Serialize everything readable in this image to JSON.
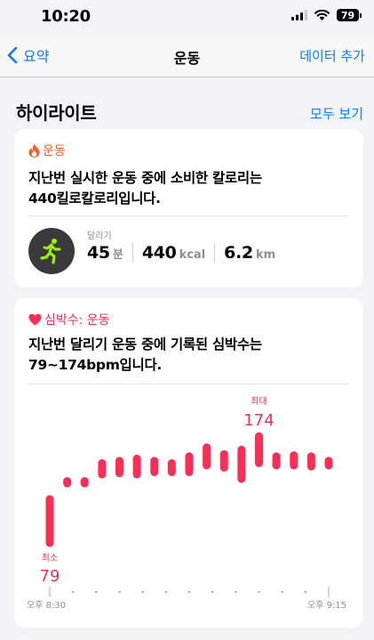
{
  "status_bar": {
    "time": "10:20",
    "battery": "79"
  },
  "nav": {
    "back_label": "요약",
    "title": "운동",
    "action_label": "데이터 추가"
  },
  "highlights": {
    "title": "하이라이트",
    "show_all": "모두 보기"
  },
  "workout_card": {
    "category": "운동",
    "headline_line1": "지난번 실시한 운동 중에 소비한 칼로리는",
    "headline_line2": "440킬로칼로리입니다.",
    "activity": "달리기",
    "metrics": [
      {
        "value": "45",
        "unit": "분"
      },
      {
        "value": "440",
        "unit": "kcal"
      },
      {
        "value": "6.2",
        "unit": "km"
      }
    ],
    "accent_color": "#ff5a1f",
    "icon": "flame-icon",
    "activity_icon": "running-figure-icon"
  },
  "heart_card": {
    "category": "심박수: 운동",
    "headline_line1": "지난번 달리기 운동 중에 기록된 심박수는",
    "headline_line2": "79~174bpm입니다.",
    "accent_color": "#ff2d55",
    "icon": "heart-icon"
  },
  "chart_data": {
    "type": "range-bar",
    "title": "",
    "unit": "bpm",
    "y_min_observed": 79,
    "y_max_observed": 174,
    "min_label": "최소",
    "max_label": "최대",
    "min_value_label": "79",
    "max_value_label": "174",
    "x_start_label": "오후 8:30",
    "x_end_label": "오후 9:15",
    "ranges": [
      [
        79,
        118
      ],
      [
        132,
        134
      ],
      [
        132,
        134
      ],
      [
        140,
        150
      ],
      [
        141,
        152
      ],
      [
        140,
        154
      ],
      [
        142,
        152
      ],
      [
        142,
        150
      ],
      [
        142,
        156
      ],
      [
        148,
        164
      ],
      [
        146,
        158
      ],
      [
        136,
        162
      ],
      [
        150,
        174
      ],
      [
        148,
        156
      ],
      [
        148,
        157
      ],
      [
        147,
        156
      ],
      [
        148,
        152
      ]
    ],
    "grid": false
  }
}
